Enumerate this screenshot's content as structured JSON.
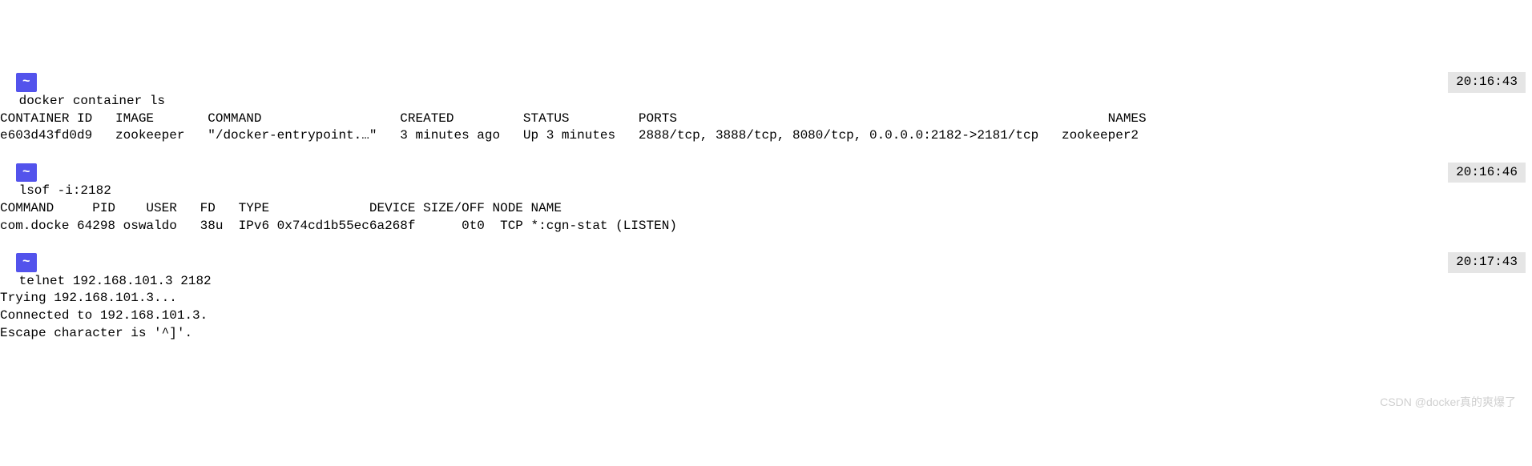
{
  "prompt": {
    "apple_glyph": "",
    "location": "~"
  },
  "blocks": [
    {
      "timestamp": "20:16:43",
      "command": "docker container ls",
      "output_lines": [
        "CONTAINER ID   IMAGE       COMMAND                  CREATED         STATUS         PORTS                                                        NAMES",
        "e603d43fd0d9   zookeeper   \"/docker-entrypoint.…\"   3 minutes ago   Up 3 minutes   2888/tcp, 3888/tcp, 8080/tcp, 0.0.0.0:2182->2181/tcp   zookeeper2"
      ]
    },
    {
      "timestamp": "20:16:46",
      "command": "lsof -i:2182",
      "output_lines": [
        "COMMAND     PID    USER   FD   TYPE             DEVICE SIZE/OFF NODE NAME",
        "com.docke 64298 oswaldo   38u  IPv6 0x74cd1b55ec6a268f      0t0  TCP *:cgn-stat (LISTEN)"
      ]
    },
    {
      "timestamp": "20:17:43",
      "command": "telnet 192.168.101.3 2182",
      "output_lines": [
        "Trying 192.168.101.3...",
        "Connected to 192.168.101.3.",
        "Escape character is '^]'."
      ]
    }
  ],
  "watermark": "CSDN @docker真的爽爆了"
}
